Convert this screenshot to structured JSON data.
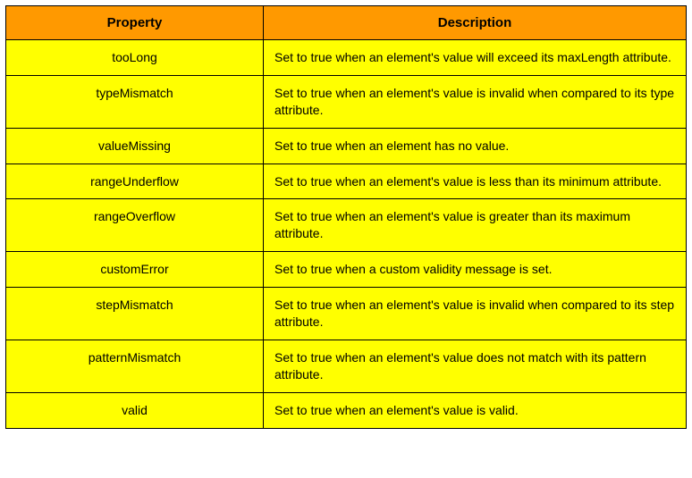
{
  "table": {
    "headers": {
      "property": "Property",
      "description": "Description"
    },
    "rows": [
      {
        "property": "tooLong",
        "description": "Set to true when an element's value will exceed its maxLength attribute."
      },
      {
        "property": "typeMismatch",
        "description": "Set to true when an element's value is invalid when compared to its type attribute."
      },
      {
        "property": "valueMissing",
        "description": "Set to true when an element has no value."
      },
      {
        "property": "rangeUnderflow",
        "description": "Set to true when an element's value is less than its minimum attribute."
      },
      {
        "property": "rangeOverflow",
        "description": "Set to true when an element's value is greater than its maximum attribute."
      },
      {
        "property": "customError",
        "description": "Set to true when a custom validity message is set."
      },
      {
        "property": "stepMismatch",
        "description": "Set to true when an element's value is invalid when compared to its step attribute."
      },
      {
        "property": "patternMismatch",
        "description": "Set to true when an element's value does not match with its pattern attribute."
      },
      {
        "property": "valid",
        "description": "Set to true when an element's value is valid."
      }
    ]
  }
}
